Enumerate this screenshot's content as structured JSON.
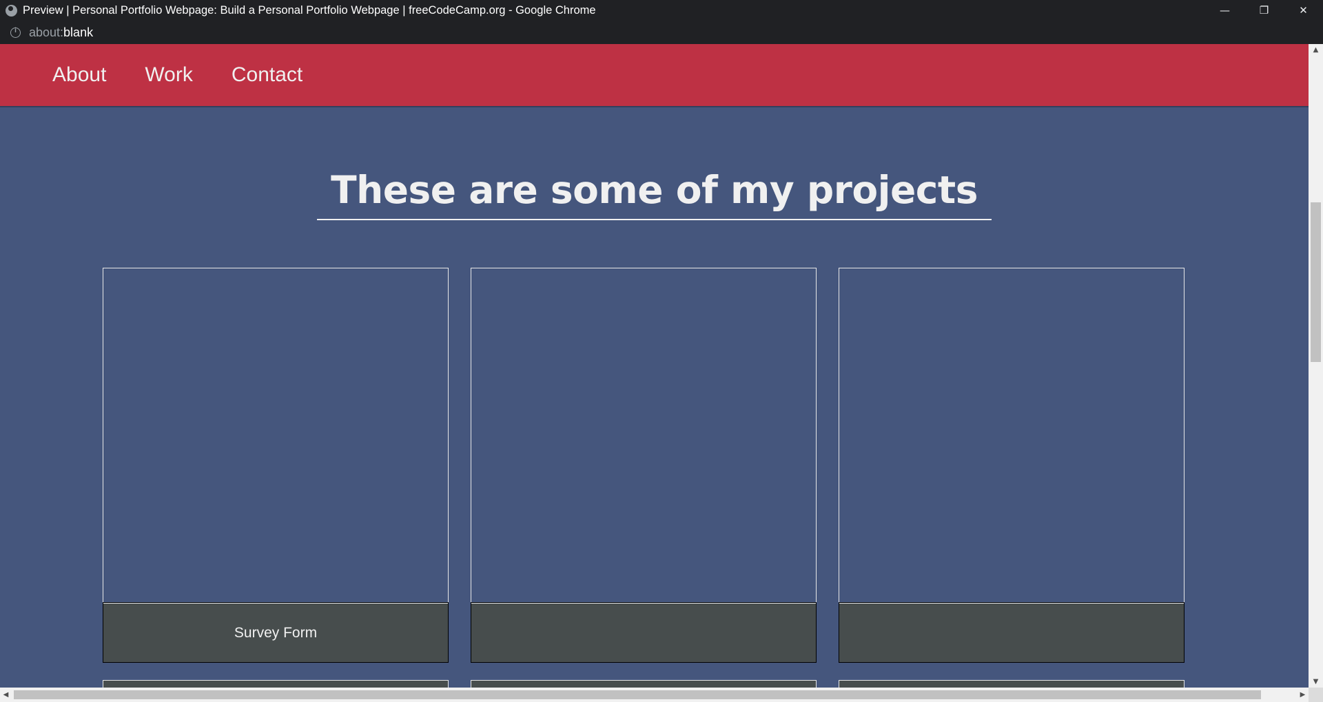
{
  "window": {
    "title": "Preview | Personal Portfolio Webpage: Build a Personal Portfolio Webpage | freeCodeCamp.org - Google Chrome",
    "controls": {
      "minimize": "—",
      "restore": "❐",
      "close": "✕"
    }
  },
  "address": {
    "scheme": "about:",
    "path": "blank"
  },
  "nav": {
    "links": [
      "About",
      "Work",
      "Contact"
    ]
  },
  "projects": {
    "heading": "These are some of my projects",
    "tiles": [
      {
        "caption": "Survey Form"
      },
      {
        "caption": ""
      },
      {
        "caption": ""
      }
    ]
  },
  "colors": {
    "navbar": "#be3144",
    "page_bg": "#45567d",
    "caption_bg": "#474d4d",
    "text": "#f0f0f0"
  }
}
